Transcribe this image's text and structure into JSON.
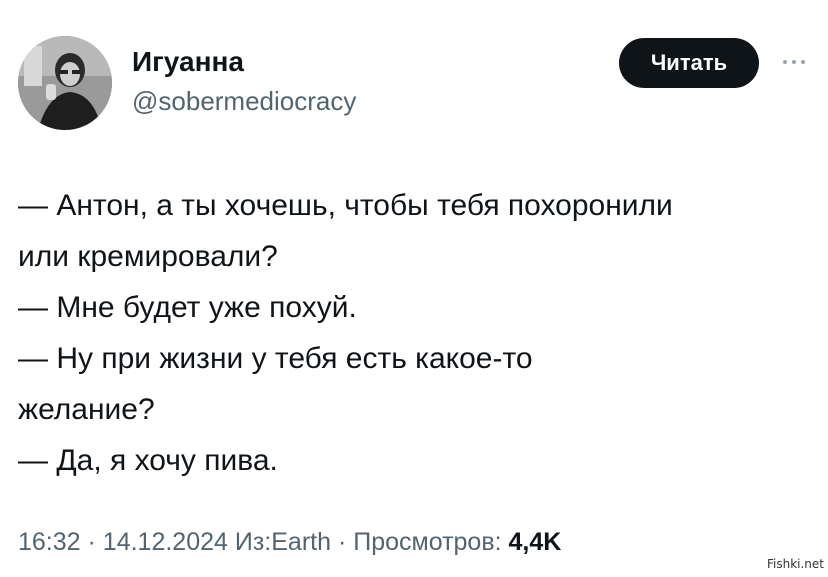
{
  "author": {
    "display_name": "Игуанна",
    "handle": "@sobermediocracy"
  },
  "follow_button": {
    "label": "Читать"
  },
  "tweet": {
    "lines": [
      "— Антон, а ты хочешь, чтобы тебя похоронили",
      "или кремировали?",
      "— Мне будет уже похуй.",
      "— Ну при жизни у тебя есть какое-то",
      "желание?",
      "— Да, я хочу пива."
    ]
  },
  "meta": {
    "time": "16:32",
    "separator": "·",
    "date": "14.12.2024",
    "source": "Из:Earth",
    "views_label": "Просмотров:",
    "views_count": "4,4K"
  },
  "watermark": "Fishki.net"
}
